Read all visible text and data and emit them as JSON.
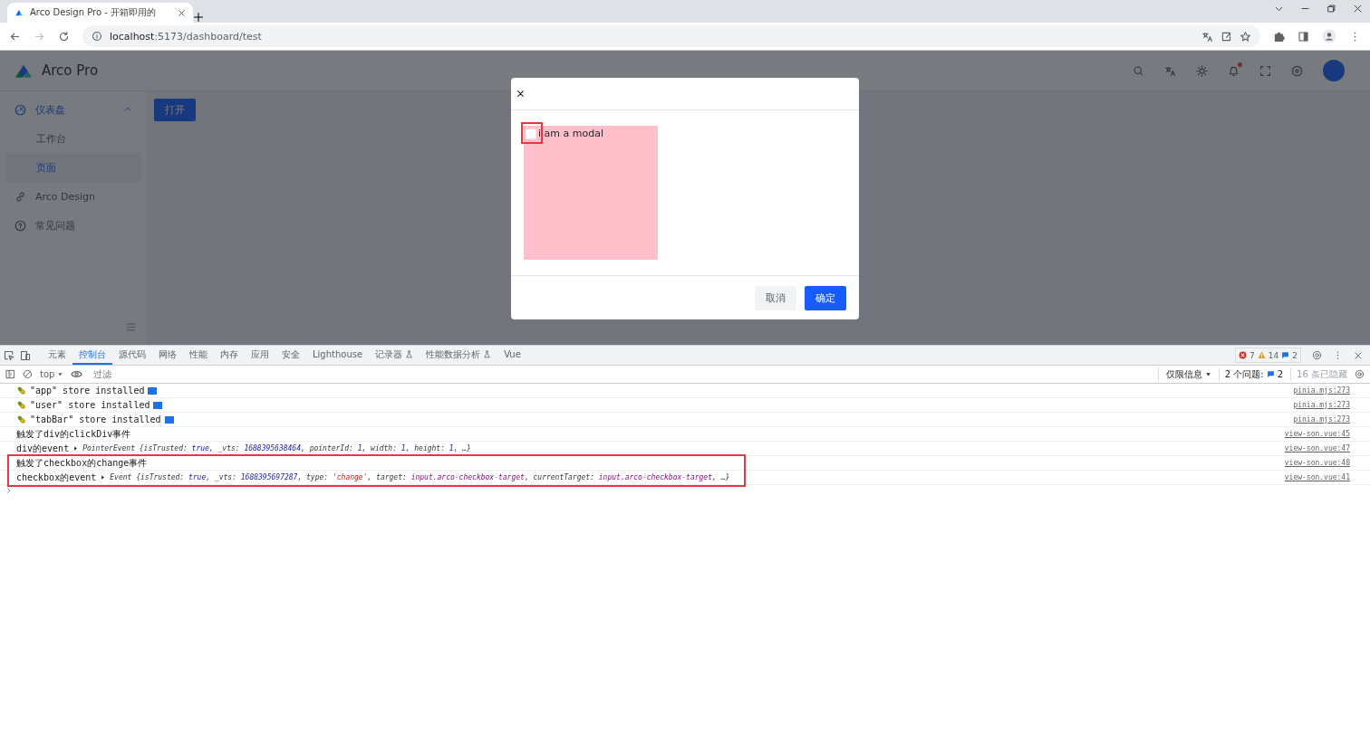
{
  "browser": {
    "tab_title": "Arco Design Pro - 开箱即用的",
    "url_host": "localhost",
    "url_path": ":5173/dashboard/test"
  },
  "app": {
    "logo_text": "Arco Pro",
    "notification_dot": true,
    "sidebar": [
      {
        "label": "仪表盘",
        "expanded": true,
        "selected": false,
        "children": [
          {
            "label": "工作台",
            "selected": false
          },
          {
            "label": "页面",
            "selected": true
          }
        ]
      },
      {
        "label": "Arco Design",
        "selected": false
      },
      {
        "label": "常见问题",
        "selected": false
      }
    ],
    "open_button": "打开",
    "modal": {
      "checkbox": {
        "label": "i am a modal",
        "checked": false,
        "annotated": true
      },
      "cancel": "取消",
      "ok": "确定"
    }
  },
  "devtools": {
    "tabs": [
      {
        "label": "元素",
        "selected": false,
        "experimental": false
      },
      {
        "label": "控制台",
        "selected": true,
        "experimental": false
      },
      {
        "label": "源代码",
        "selected": false,
        "experimental": false
      },
      {
        "label": "网络",
        "selected": false,
        "experimental": false
      },
      {
        "label": "性能",
        "selected": false,
        "experimental": false
      },
      {
        "label": "内存",
        "selected": false,
        "experimental": false
      },
      {
        "label": "应用",
        "selected": false,
        "experimental": false
      },
      {
        "label": "安全",
        "selected": false,
        "experimental": false
      },
      {
        "label": "Lighthouse",
        "selected": false,
        "experimental": false
      },
      {
        "label": "记录器",
        "selected": false,
        "experimental": true
      },
      {
        "label": "性能数据分析",
        "selected": false,
        "experimental": true
      },
      {
        "label": "Vue",
        "selected": false,
        "experimental": false
      }
    ],
    "errors": "7",
    "warnings": "14",
    "infos": "2",
    "context": "top",
    "filter_placeholder": "过滤",
    "levels": "仅限信息",
    "issues_label": "2 个问题:",
    "issues_count": "2",
    "hidden": "16 条已隐藏",
    "logs": [
      {
        "kind": "pinia",
        "highlighted": false,
        "parts": [
          {
            "text": "\"app\" store installed",
            "kind": "plain"
          }
        ],
        "source": "pinia.mjs:273"
      },
      {
        "kind": "pinia",
        "highlighted": false,
        "parts": [
          {
            "text": "\"user\" store installed",
            "kind": "plain"
          }
        ],
        "source": "pinia.mjs:273"
      },
      {
        "kind": "pinia",
        "highlighted": false,
        "parts": [
          {
            "text": "\"tabBar\" store installed",
            "kind": "plain"
          }
        ],
        "source": "pinia.mjs:273"
      },
      {
        "kind": "text",
        "highlighted": false,
        "parts": [
          {
            "text": "触发了div的clickDiv事件",
            "kind": "plain"
          }
        ],
        "source": "view-son.vue:45"
      },
      {
        "kind": "object",
        "highlighted": false,
        "label": "div的event",
        "parts": [
          {
            "text": "PointerEvent {",
            "kind": "italic"
          },
          {
            "text": "isTrusted: ",
            "kind": "italic"
          },
          {
            "text": "true",
            "kind": "value"
          },
          {
            "text": ", _vts: ",
            "kind": "italic"
          },
          {
            "text": "1688395638464",
            "kind": "value"
          },
          {
            "text": ", pointerId: ",
            "kind": "italic"
          },
          {
            "text": "1",
            "kind": "value"
          },
          {
            "text": ", width: ",
            "kind": "italic"
          },
          {
            "text": "1",
            "kind": "value"
          },
          {
            "text": ", height: ",
            "kind": "italic"
          },
          {
            "text": "1",
            "kind": "value"
          },
          {
            "text": ", …}",
            "kind": "italic"
          }
        ],
        "source": "view-son.vue:47"
      },
      {
        "kind": "text",
        "highlighted": true,
        "parts": [
          {
            "text": "触发了checkbox的change事件",
            "kind": "plain"
          }
        ],
        "source": "view-son.vue:40"
      },
      {
        "kind": "object",
        "highlighted": true,
        "label": "checkbox的event",
        "parts": [
          {
            "text": "Event {",
            "kind": "italic"
          },
          {
            "text": "isTrusted: ",
            "kind": "italic"
          },
          {
            "text": "true",
            "kind": "value"
          },
          {
            "text": ", _vts: ",
            "kind": "italic"
          },
          {
            "text": "1688395697287",
            "kind": "value"
          },
          {
            "text": ", type: ",
            "kind": "italic"
          },
          {
            "text": "'change'",
            "kind": "string"
          },
          {
            "text": ", target: ",
            "kind": "italic"
          },
          {
            "text": "input.arco-checkbox-target",
            "kind": "node"
          },
          {
            "text": ", currentTarget: ",
            "kind": "italic"
          },
          {
            "text": "input.arco-checkbox-target",
            "kind": "node"
          },
          {
            "text": ", …}",
            "kind": "italic"
          }
        ],
        "source": "view-son.vue:41"
      }
    ]
  }
}
